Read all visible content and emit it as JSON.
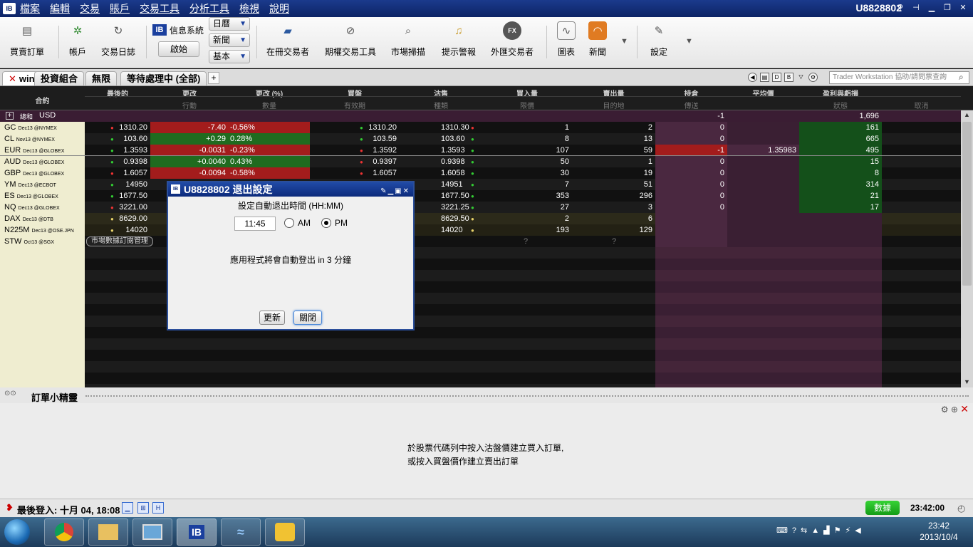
{
  "window": {
    "menus": [
      "檔案",
      "編輯",
      "交易",
      "賬戶",
      "交易工具",
      "分析工具",
      "檢視",
      "說明"
    ],
    "account": "U8828802",
    "logo": "IB"
  },
  "toolbar": {
    "buttons": [
      {
        "label": "買賣訂單",
        "icon": "order-icon"
      },
      {
        "label": "帳戶",
        "icon": "account-icon"
      },
      {
        "label": "交易日誌",
        "icon": "journal-icon"
      },
      {
        "label": "在冊交易者",
        "icon": "book-icon"
      },
      {
        "label": "期權交易工具",
        "icon": "options-icon"
      },
      {
        "label": "市場掃描",
        "icon": "scanner-icon"
      },
      {
        "label": "提示警報",
        "icon": "alert-bell-icon"
      },
      {
        "label": "外匯交易者",
        "icon": "fx-icon"
      },
      {
        "label": "圖表",
        "icon": "chart-icon"
      },
      {
        "label": "新聞",
        "icon": "rss-icon"
      },
      {
        "label": "設定",
        "icon": "settings-icon"
      }
    ],
    "ib_badge": "IB",
    "info_system": "信息系統",
    "start": "啟始",
    "dropdowns": [
      "日曆",
      "新聞",
      "基本"
    ]
  },
  "tabs": {
    "items": [
      "win",
      "投資組合",
      "無限",
      "等待處理中 (全部)"
    ],
    "add": "+",
    "search_placeholder": "Trader Workstation 協助/請問票查詢"
  },
  "columns": {
    "top": [
      "合約",
      "最後的",
      "更改",
      "更改 (%)",
      "買盤",
      "沽售",
      "買入量",
      "賣出量",
      "持倉",
      "平均價",
      "盈利與虧損"
    ],
    "sub": [
      "行動",
      "數量",
      "有效期",
      "種類",
      "限價",
      "目的地",
      "傳送",
      "狀態",
      "取消"
    ]
  },
  "summary": {
    "label": "總和",
    "currency": "USD",
    "position": "-1",
    "pnl": "1,696"
  },
  "rows": [
    {
      "sym": "GC",
      "exch": "Dec13 @NYMEX",
      "last": "1310.20",
      "ld": "red",
      "chg": "-7.40",
      "pct": "-0.56%",
      "cc": "neg",
      "bid": "1310.20",
      "bd": "grn",
      "ask": "1310.30",
      "ad": "red",
      "bsz": "1",
      "asz": "2",
      "pos": "0",
      "avg": "",
      "pnl": "161"
    },
    {
      "sym": "CL",
      "exch": "Nov13 @NYMEX",
      "last": "103.60",
      "ld": "grn",
      "chg": "+0.29",
      "pct": "0.28%",
      "cc": "pos",
      "bid": "103.59",
      "bd": "grn",
      "ask": "103.60",
      "ad": "grn",
      "bsz": "8",
      "asz": "13",
      "pos": "0",
      "avg": "",
      "pnl": "665"
    },
    {
      "sym": "EUR",
      "exch": "Dec13 @GLOBEX",
      "last": "1.3593",
      "ld": "grn",
      "chg": "-0.0031",
      "pct": "-0.23%",
      "cc": "neg",
      "bid": "1.3592",
      "bd": "red",
      "ask": "1.3593",
      "ad": "grn",
      "bsz": "107",
      "asz": "59",
      "pos": "-1",
      "avg": "1.35983",
      "pnl": "495"
    },
    {
      "sym": "AUD",
      "exch": "Dec13 @GLOBEX",
      "last": "0.9398",
      "ld": "grn",
      "chg": "+0.0040",
      "pct": "0.43%",
      "cc": "pos",
      "bid": "0.9397",
      "bd": "red",
      "ask": "0.9398",
      "ad": "grn",
      "bsz": "50",
      "asz": "1",
      "pos": "0",
      "avg": "",
      "pnl": "15"
    },
    {
      "sym": "GBP",
      "exch": "Dec13 @GLOBEX",
      "last": "1.6057",
      "ld": "red",
      "chg": "-0.0094",
      "pct": "-0.58%",
      "cc": "neg",
      "bid": "1.6057",
      "bd": "red",
      "ask": "1.6058",
      "ad": "grn",
      "bsz": "30",
      "asz": "19",
      "pos": "0",
      "avg": "",
      "pnl": "8"
    },
    {
      "sym": "YM",
      "exch": "Dec13 @ECBOT",
      "last": "14950",
      "ld": "grn",
      "chg": "",
      "pct": "",
      "cc": "",
      "bid": "",
      "bd": "",
      "ask": "14951",
      "ad": "grn",
      "bsz": "7",
      "asz": "51",
      "pos": "0",
      "avg": "",
      "pnl": "314"
    },
    {
      "sym": "ES",
      "exch": "Dec13 @GLOBEX",
      "last": "1677.50",
      "ld": "grn",
      "chg": "",
      "pct": "",
      "cc": "",
      "bid": "",
      "bd": "",
      "ask": "1677.50",
      "ad": "grn",
      "bsz": "353",
      "asz": "296",
      "pos": "0",
      "avg": "",
      "pnl": "21"
    },
    {
      "sym": "NQ",
      "exch": "Dec13 @GLOBEX",
      "last": "3221.00",
      "ld": "red",
      "chg": "",
      "pct": "",
      "cc": "",
      "bid": "",
      "bd": "",
      "ask": "3221.25",
      "ad": "grn",
      "bsz": "27",
      "asz": "3",
      "pos": "0",
      "avg": "",
      "pnl": "17"
    },
    {
      "sym": "DAX",
      "exch": "Dec13 @DTB",
      "last": "8629.00",
      "ld": "yel",
      "chg": "",
      "pct": "",
      "cc": "",
      "bid": "",
      "bd": "",
      "ask": "8629.50",
      "ad": "yel",
      "bsz": "2",
      "asz": "6",
      "pos": "",
      "avg": "",
      "pnl": ""
    },
    {
      "sym": "N225M",
      "exch": "Dec13 @OSE.JPN",
      "last": "14020",
      "ld": "yel",
      "chg": "",
      "pct": "",
      "cc": "",
      "bid": "",
      "bd": "",
      "ask": "14020",
      "ad": "yel",
      "bsz": "193",
      "asz": "129",
      "pos": "",
      "avg": "",
      "pnl": ""
    },
    {
      "sym": "STW",
      "exch": "Oct13 @SGX",
      "last": "",
      "ld": "",
      "chg": "",
      "pct": "",
      "cc": "",
      "bid": "",
      "bd": "",
      "ask": "",
      "ad": "",
      "bsz": "?",
      "asz": "?",
      "pos": "",
      "avg": "",
      "pnl": ""
    }
  ],
  "stw_button": "市場數據訂閱管理",
  "dialog": {
    "title": "U8828802 退出設定",
    "logo": "IB",
    "prompt": "設定自動退出時間 (HH:MM)",
    "time": "11:45",
    "am": "AM",
    "pm": "PM",
    "selected": "PM",
    "message": "應用程式將會自動登出 in 3 分鐘",
    "update": "更新",
    "close": "關閉"
  },
  "order_wizard": {
    "title": "訂單小精靈",
    "line1": "於股票代碼列中按入沽盤價建立買入訂單,",
    "line2": "或按入買盤價作建立賣出訂單"
  },
  "status": {
    "last_login": "最後登入: 十月 04, 18:08",
    "data": "數據",
    "time": "23:42:00"
  },
  "taskbar": {
    "clock_time": "23:42",
    "clock_date": "2013/10/4",
    "ib": "IB"
  }
}
